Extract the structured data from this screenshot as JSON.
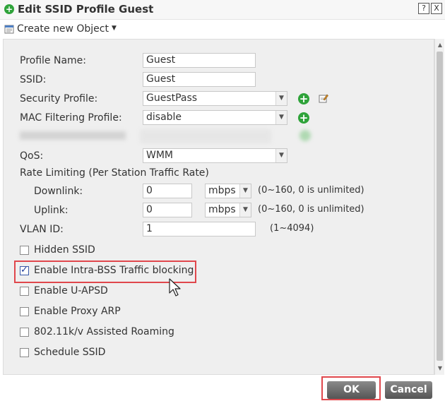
{
  "window": {
    "title": "Edit SSID Profile Guest",
    "help_label": "?",
    "close_label": "X"
  },
  "toolbar": {
    "create_label": "Create new Object"
  },
  "form": {
    "profile_name_label": "Profile Name:",
    "profile_name_value": "Guest",
    "ssid_label": "SSID:",
    "ssid_value": "Guest",
    "security_profile_label": "Security Profile:",
    "security_profile_value": "GuestPass",
    "mac_filtering_label": "MAC Filtering Profile:",
    "mac_filtering_value": "disable",
    "qos_label": "QoS:",
    "qos_value": "WMM",
    "rate_limiting_label": "Rate Limiting (Per Station Traffic Rate)",
    "downlink_label": "Downlink:",
    "downlink_value": "0",
    "downlink_unit": "mbps",
    "downlink_hint": "(0~160, 0 is unlimited)",
    "uplink_label": "Uplink:",
    "uplink_value": "0",
    "uplink_unit": "mbps",
    "uplink_hint": "(0~160, 0 is unlimited)",
    "vlan_label": "VLAN ID:",
    "vlan_value": "1",
    "vlan_hint": "(1~4094)"
  },
  "checkboxes": [
    {
      "label": "Hidden SSID",
      "checked": false
    },
    {
      "label": "Enable Intra-BSS Traffic blocking",
      "checked": true
    },
    {
      "label": "Enable U-APSD",
      "checked": false
    },
    {
      "label": "Enable Proxy ARP",
      "checked": false
    },
    {
      "label": "802.11k/v Assisted Roaming",
      "checked": false
    },
    {
      "label": "Schedule SSID",
      "checked": false
    }
  ],
  "buttons": {
    "ok_label": "OK",
    "cancel_label": "Cancel"
  },
  "colors": {
    "accent_green": "#2fa33a",
    "highlight_red": "#e0474c",
    "panel_bg": "#efefef"
  }
}
